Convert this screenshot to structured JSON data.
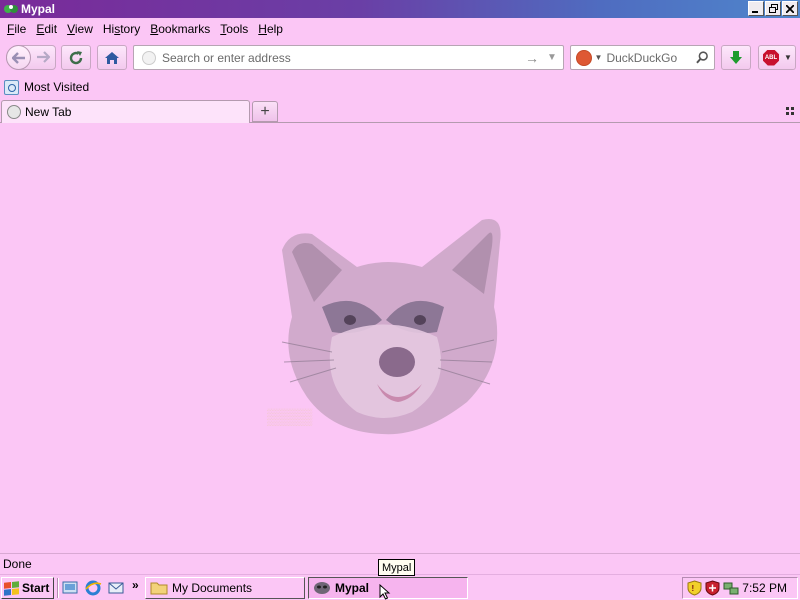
{
  "window": {
    "title": "Mypal"
  },
  "menu": [
    {
      "pre": "",
      "u": "F",
      "post": "ile"
    },
    {
      "pre": "",
      "u": "E",
      "post": "dit"
    },
    {
      "pre": "",
      "u": "V",
      "post": "iew"
    },
    {
      "pre": "Hi",
      "u": "s",
      "post": "tory"
    },
    {
      "pre": "",
      "u": "B",
      "post": "ookmarks"
    },
    {
      "pre": "",
      "u": "T",
      "post": "ools"
    },
    {
      "pre": "",
      "u": "H",
      "post": "elp"
    }
  ],
  "navbar": {
    "url_placeholder": "Search or enter address",
    "search_engine": "DuckDuckGo",
    "adblock_badge": "ABL"
  },
  "bookmarks": {
    "most_visited": "Most Visited"
  },
  "tabs": {
    "active_label": "New Tab",
    "new_tab_symbol": "+"
  },
  "status": {
    "text": "Done"
  },
  "taskbar": {
    "start_label": "Start",
    "more_symbol": "»",
    "tasks": [
      "My Documents",
      "Mypal"
    ],
    "clock": "7:52 PM"
  },
  "tooltip": {
    "text": "Mypal"
  },
  "colors": {
    "background": "#fbc6f5",
    "title_gradient_start": "#7a2a99",
    "title_gradient_end": "#4f86cc",
    "download_green": "#1f9c2e"
  }
}
